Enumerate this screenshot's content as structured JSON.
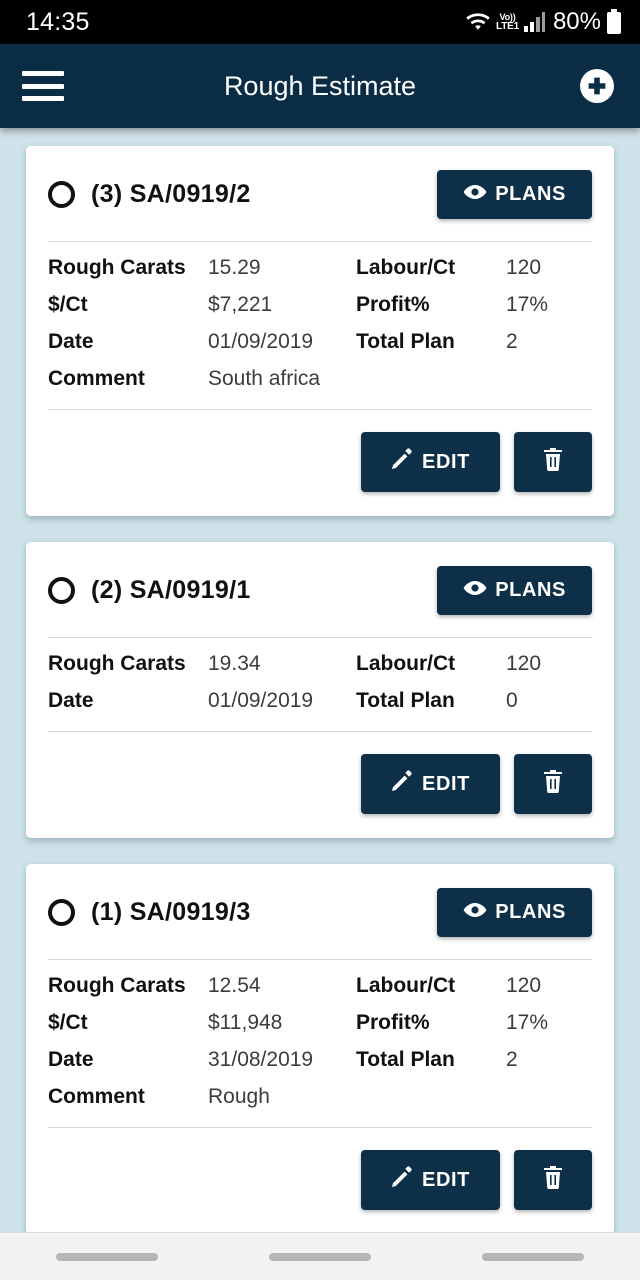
{
  "status_bar": {
    "time": "14:35",
    "network_label_top": "Vo))",
    "network_label_bottom": "LTE1",
    "battery_percent": "80%",
    "icons": [
      "wifi-icon",
      "volte-icon",
      "signal-icon",
      "battery-icon"
    ]
  },
  "app_bar": {
    "title": "Rough Estimate",
    "menu_icon": "hamburger-menu-icon",
    "add_icon": "add-circle-icon",
    "bg_color": "#0b2c45"
  },
  "theme": {
    "page_bg": "#cfe2e9",
    "card_bg": "#ffffff",
    "button_navy": "#0e2f48",
    "label_color": "#111111",
    "value_color": "#3c3c3c"
  },
  "cards": [
    {
      "index_label": "(3)",
      "code": "SA/0919/2",
      "title": "(3) SA/0919/2",
      "plans_label": "PLANS",
      "edit_label": "EDIT",
      "rows": [
        {
          "label_left": "Rough Carats",
          "value_left": "15.29",
          "label_right": "Labour/Ct",
          "value_right": "120"
        },
        {
          "label_left": "$/Ct",
          "value_left": "$7,221",
          "label_right": "Profit%",
          "value_right": "17%"
        },
        {
          "label_left": "Date",
          "value_left": "01/09/2019",
          "label_right": "Total Plan",
          "value_right": "2"
        },
        {
          "label_left": "Comment",
          "value_left": "South africa",
          "label_right": "",
          "value_right": ""
        }
      ]
    },
    {
      "index_label": "(2)",
      "code": "SA/0919/1",
      "title": "(2) SA/0919/1",
      "plans_label": "PLANS",
      "edit_label": "EDIT",
      "rows": [
        {
          "label_left": "Rough Carats",
          "value_left": "19.34",
          "label_right": "Labour/Ct",
          "value_right": "120"
        },
        {
          "label_left": "Date",
          "value_left": "01/09/2019",
          "label_right": "Total Plan",
          "value_right": "0"
        }
      ]
    },
    {
      "index_label": "(1)",
      "code": "SA/0919/3",
      "title": "(1) SA/0919/3",
      "plans_label": "PLANS",
      "edit_label": "EDIT",
      "rows": [
        {
          "label_left": "Rough Carats",
          "value_left": "12.54",
          "label_right": "Labour/Ct",
          "value_right": "120"
        },
        {
          "label_left": "$/Ct",
          "value_left": "$11,948",
          "label_right": "Profit%",
          "value_right": "17%"
        },
        {
          "label_left": "Date",
          "value_left": "31/08/2019",
          "label_right": "Total Plan",
          "value_right": "2"
        },
        {
          "label_left": "Comment",
          "value_left": "Rough",
          "label_right": "",
          "value_right": ""
        }
      ]
    }
  ],
  "nav_bar": {
    "pills": 3
  }
}
